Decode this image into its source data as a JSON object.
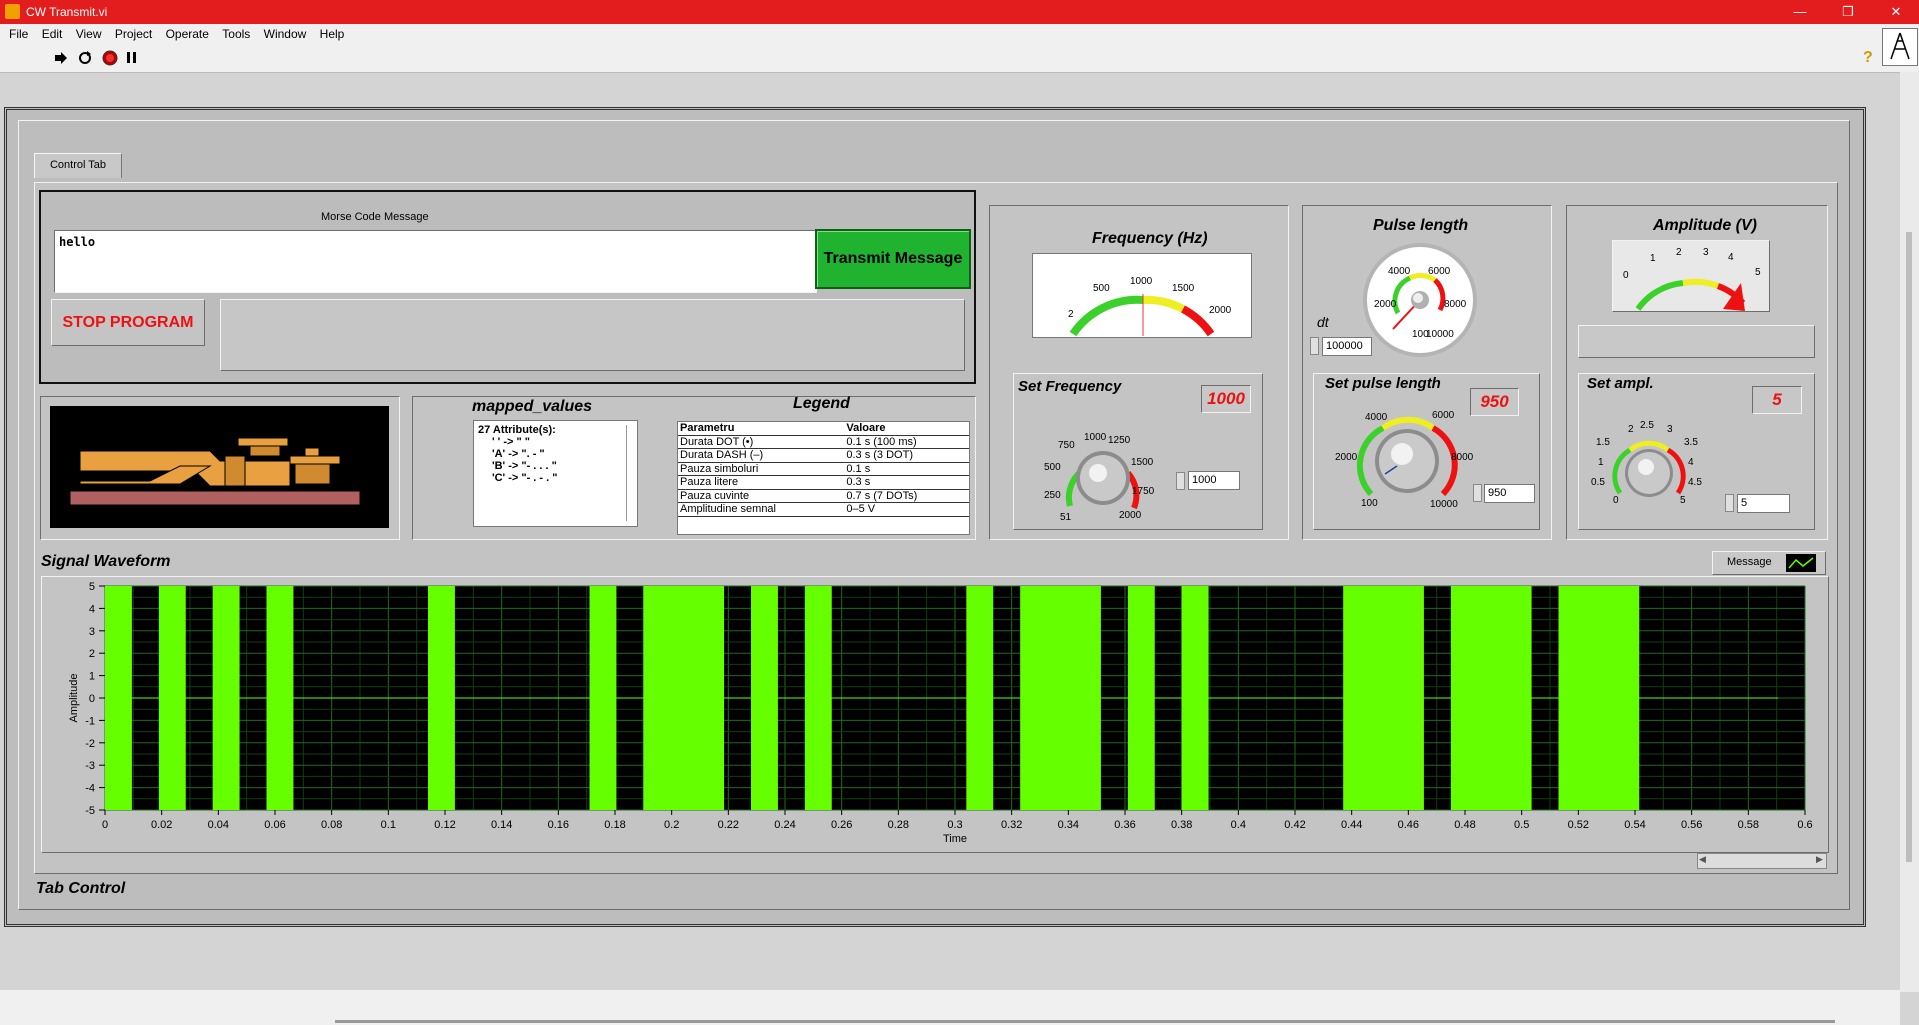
{
  "window": {
    "title": "CW Transmit.vi",
    "help_icon": "help-icon"
  },
  "menu": [
    "File",
    "Edit",
    "View",
    "Project",
    "Operate",
    "Tools",
    "Window",
    "Help"
  ],
  "toolbar": {
    "icons": [
      "run-arrow-icon",
      "run-continuous-icon",
      "abort-icon",
      "pause-icon"
    ]
  },
  "tab": {
    "label": "Control Tab",
    "caption": "Tab Control"
  },
  "message": {
    "label": "Morse Code Message",
    "value": "hello",
    "transmit_label": "Transmit Message",
    "stop_label": "STOP PROGRAM"
  },
  "mapped_values": {
    "title": "mapped_values",
    "items": [
      "27 Attribute(s):",
      "' ' -> \"        \"",
      "'A' -> \". -    \"",
      "'B' -> \"- . . .    \"",
      "'C' -> \"- . - .    \""
    ]
  },
  "legend": {
    "title": "Legend",
    "headers": [
      "Parametru",
      "Valoare"
    ],
    "rows": [
      [
        "Durata DOT (•)",
        "0.1 s (100 ms)"
      ],
      [
        "Durata DASH (–)",
        "0.3 s (3 DOT)"
      ],
      [
        "Pauza simboluri",
        "0.1 s"
      ],
      [
        "Pauza litere",
        "0.3 s"
      ],
      [
        "Pauza cuvinte",
        "0.7 s (7 DOTs)"
      ],
      [
        "Amplitudine semnal",
        "0–5 V"
      ]
    ]
  },
  "frequency": {
    "title": "Frequency (Hz)",
    "meter_ticks": [
      "2",
      "500",
      "1000",
      "1500",
      "2000"
    ],
    "meter_value": 1000,
    "set_label": "Set Frequency",
    "indicator": "1000",
    "knob_ticks": [
      "51",
      "250",
      "500",
      "750",
      "1000",
      "1250",
      "1500",
      "1750",
      "2000"
    ],
    "numeric": "1000"
  },
  "pulse": {
    "title": "Pulse length",
    "gauge_ticks": [
      "100",
      "2000",
      "4000",
      "6000",
      "8000",
      "10000"
    ],
    "gauge_value": 950,
    "dt_label": "dt",
    "dt_value": "100000",
    "set_label": "Set pulse length",
    "indicator": "950",
    "knob_ticks": [
      "100",
      "2000",
      "4000",
      "6000",
      "8000",
      "10000"
    ],
    "numeric": "950"
  },
  "amplitude": {
    "title": "Amplitude (V)",
    "meter_ticks": [
      "0",
      "1",
      "2",
      "3",
      "4",
      "5"
    ],
    "meter_value": 5,
    "set_label": "Set ampl.",
    "indicator": "5",
    "knob_ticks": [
      "0",
      "0.5",
      "1",
      "1.5",
      "2",
      "2.5",
      "3",
      "3.5",
      "4",
      "4.5",
      "5"
    ],
    "numeric": "5"
  },
  "chart_data": {
    "type": "line",
    "title": "Signal Waveform",
    "xlabel": "Time",
    "ylabel": "Amplitude",
    "legend": "Message",
    "xlim": [
      0,
      0.6
    ],
    "ylim": [
      -5,
      5
    ],
    "xticks": [
      "0",
      "0.02",
      "0.04",
      "0.06",
      "0.08",
      "0.1",
      "0.12",
      "0.14",
      "0.16",
      "0.18",
      "0.2",
      "0.22",
      "0.24",
      "0.26",
      "0.28",
      "0.3",
      "0.32",
      "0.34",
      "0.36",
      "0.38",
      "0.4",
      "0.42",
      "0.44",
      "0.46",
      "0.48",
      "0.5",
      "0.52",
      "0.54",
      "0.56",
      "0.58",
      "0.6"
    ],
    "yticks": [
      "5",
      "4",
      "3",
      "2",
      "1",
      "0",
      "-1",
      "-2",
      "-3",
      "-4",
      "-5"
    ],
    "series": [
      {
        "name": "Message",
        "color": "#66ff00",
        "pulses": [
          [
            0.0,
            0.0095
          ],
          [
            0.019,
            0.0285
          ],
          [
            0.038,
            0.0475
          ],
          [
            0.057,
            0.0665
          ],
          [
            0.114,
            0.1235
          ],
          [
            0.171,
            0.1805
          ],
          [
            0.19,
            0.2185
          ],
          [
            0.228,
            0.2375
          ],
          [
            0.247,
            0.2565
          ],
          [
            0.304,
            0.3135
          ],
          [
            0.323,
            0.3515
          ],
          [
            0.361,
            0.3705
          ],
          [
            0.38,
            0.3895
          ],
          [
            0.437,
            0.4655
          ],
          [
            0.475,
            0.5035
          ],
          [
            0.513,
            0.5415
          ]
        ],
        "baseline_end": 0.5905
      }
    ]
  },
  "colors": {
    "background": "#d4d4d4",
    "panel": "#bdbdbd",
    "titlebar": "#e31d1d",
    "transmit": "#1fb32f",
    "plot_bg": "#000000",
    "trace": "#66ff00",
    "indicator_text": "#ee1111"
  }
}
